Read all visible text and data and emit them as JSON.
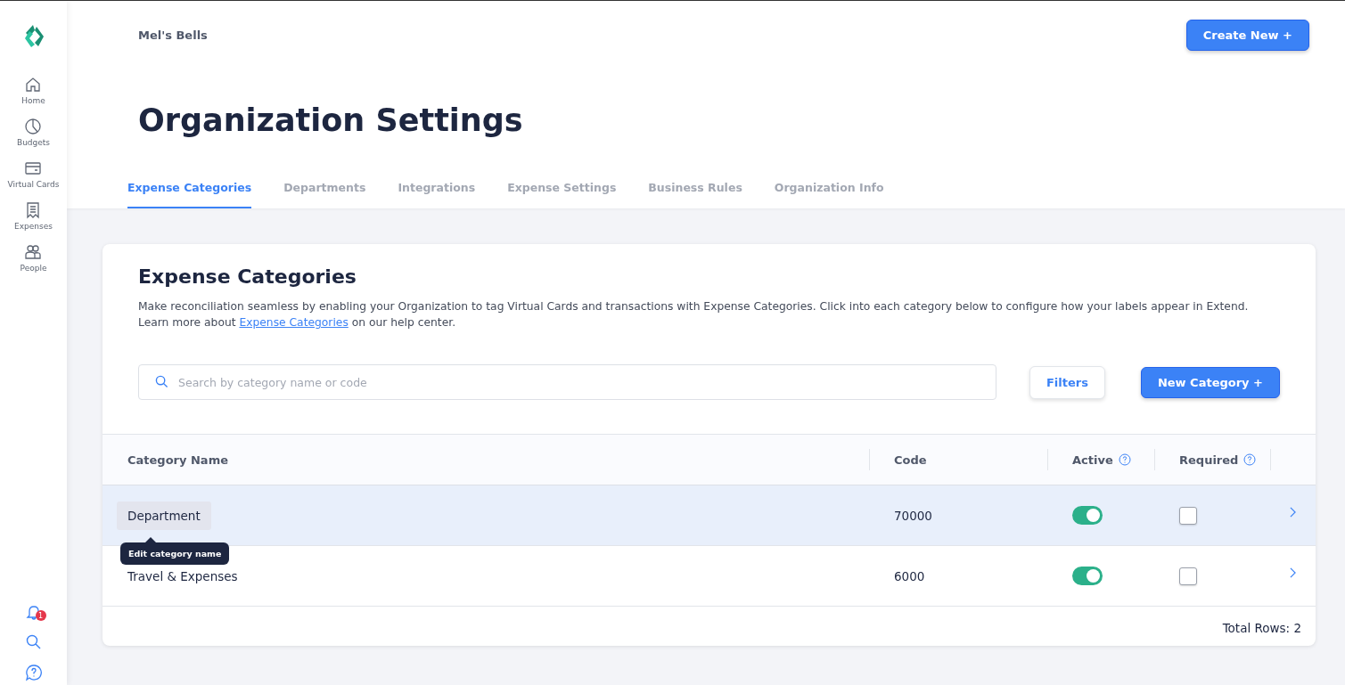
{
  "sidebar": {
    "items": [
      {
        "label": "Home"
      },
      {
        "label": "Budgets"
      },
      {
        "label": "Virtual Cards"
      },
      {
        "label": "Expenses"
      },
      {
        "label": "People"
      }
    ],
    "notification_badge": "1"
  },
  "header": {
    "org_name": "Mel's Bells",
    "create_button": "Create New +"
  },
  "page_title": "Organization Settings",
  "tabs": [
    {
      "label": "Expense Categories",
      "selected": true
    },
    {
      "label": "Departments",
      "selected": false
    },
    {
      "label": "Integrations",
      "selected": false
    },
    {
      "label": "Expense Settings",
      "selected": false
    },
    {
      "label": "Business Rules",
      "selected": false
    },
    {
      "label": "Organization Info",
      "selected": false
    }
  ],
  "card": {
    "title": "Expense Categories",
    "description_before": "Make reconciliation seamless by enabling your Organization to tag Virtual Cards and transactions with Expense Categories. Click into each category below to configure how your labels appear in Extend. Learn more about ",
    "description_link": "Expense Categories",
    "description_after": " on our help center.",
    "search": {
      "placeholder": "Search by category name or code"
    },
    "filters_button": "Filters",
    "new_button": "New Category +",
    "table": {
      "columns": [
        {
          "label": "Category Name",
          "help": false
        },
        {
          "label": "Code",
          "help": false
        },
        {
          "label": "Active",
          "help": true
        },
        {
          "label": "Required",
          "help": true
        }
      ],
      "rows": [
        {
          "name": "Department",
          "code": "70000",
          "active": true,
          "required": false,
          "selected": true,
          "tooltip": "Edit category name"
        },
        {
          "name": "Travel & Expenses",
          "code": "6000",
          "active": true,
          "required": false,
          "selected": false
        }
      ]
    },
    "total_rows": "Total Rows: 2"
  }
}
